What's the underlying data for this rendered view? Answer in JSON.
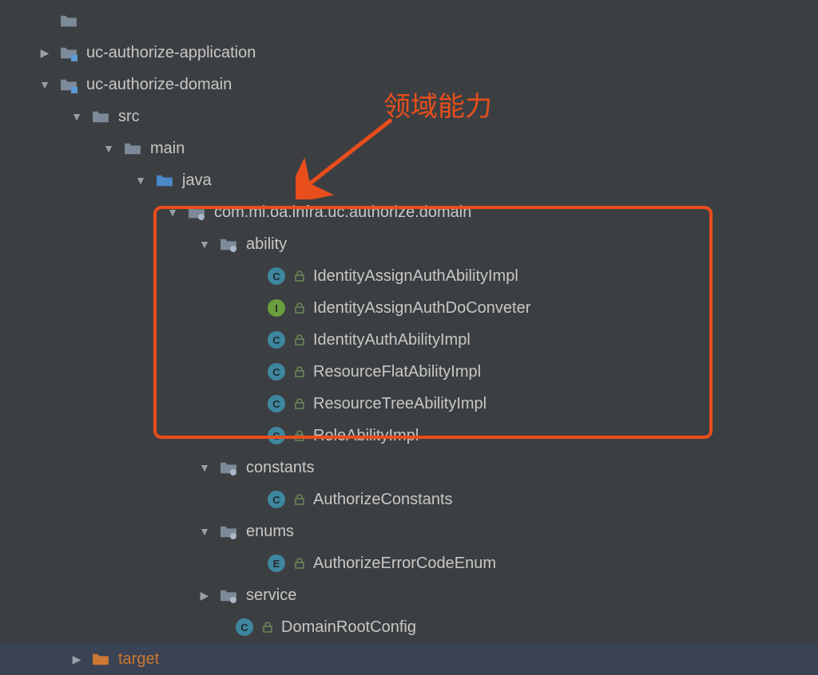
{
  "annotation": {
    "text": "领域能力"
  },
  "tree": [
    {
      "indent": 48,
      "arrow": "none",
      "iconType": "folder-grey",
      "label": ""
    },
    {
      "indent": 48,
      "arrow": "right",
      "iconType": "module",
      "label": "uc-authorize-application"
    },
    {
      "indent": 48,
      "arrow": "down",
      "iconType": "module",
      "label": "uc-authorize-domain"
    },
    {
      "indent": 88,
      "arrow": "down",
      "iconType": "folder-grey",
      "label": "src"
    },
    {
      "indent": 128,
      "arrow": "down",
      "iconType": "folder-grey",
      "label": "main"
    },
    {
      "indent": 168,
      "arrow": "down",
      "iconType": "folder-blue",
      "label": "java"
    },
    {
      "indent": 208,
      "arrow": "down",
      "iconType": "package",
      "label": "com.mi.oa.infra.uc.authorize.domain"
    },
    {
      "indent": 248,
      "arrow": "down",
      "iconType": "package",
      "label": "ability"
    },
    {
      "indent": 308,
      "arrow": "none",
      "iconType": "class-c",
      "lock": true,
      "label": "IdentityAssignAuthAbilityImpl"
    },
    {
      "indent": 308,
      "arrow": "none",
      "iconType": "class-i",
      "lock": true,
      "label": "IdentityAssignAuthDoConveter"
    },
    {
      "indent": 308,
      "arrow": "none",
      "iconType": "class-c",
      "lock": true,
      "label": "IdentityAuthAbilityImpl"
    },
    {
      "indent": 308,
      "arrow": "none",
      "iconType": "class-c",
      "lock": true,
      "label": "ResourceFlatAbilityImpl"
    },
    {
      "indent": 308,
      "arrow": "none",
      "iconType": "class-c",
      "lock": true,
      "label": "ResourceTreeAbilityImpl"
    },
    {
      "indent": 308,
      "arrow": "none",
      "iconType": "class-c",
      "lock": true,
      "label": "RoleAbilityImpl"
    },
    {
      "indent": 248,
      "arrow": "down",
      "iconType": "package",
      "label": "constants"
    },
    {
      "indent": 308,
      "arrow": "none",
      "iconType": "class-c",
      "lock": true,
      "label": "AuthorizeConstants"
    },
    {
      "indent": 248,
      "arrow": "down",
      "iconType": "package",
      "label": "enums"
    },
    {
      "indent": 308,
      "arrow": "none",
      "iconType": "class-e",
      "lock": true,
      "label": "AuthorizeErrorCodeEnum"
    },
    {
      "indent": 248,
      "arrow": "right",
      "iconType": "package",
      "label": "service"
    },
    {
      "indent": 268,
      "arrow": "none",
      "iconType": "class-c",
      "lock": true,
      "label": "DomainRootConfig"
    },
    {
      "indent": 88,
      "arrow": "right",
      "iconType": "folder-orange",
      "label": "target",
      "excluded": true,
      "selected": true
    }
  ]
}
